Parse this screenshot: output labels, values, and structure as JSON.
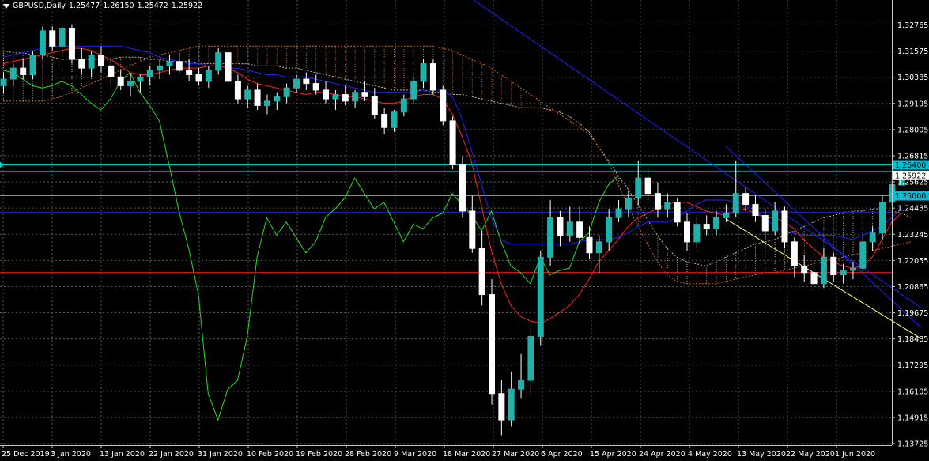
{
  "header": {
    "symbol": "GBPUSD,Daily",
    "open": "1.25477",
    "high": "1.26150",
    "low": "1.25472",
    "close": "1.25922"
  },
  "colors": {
    "background": "#000000",
    "grid": "#5a5a5a",
    "axis": "#c8c8c8",
    "bull_body": "#20b2aa",
    "bear_body": "#ffffff",
    "tenkan": "#ff2020",
    "kijun": "#2020ff",
    "chikou": "#20e020",
    "cloud_a": "#d2b48c",
    "cloud_b": "#d2691e",
    "trendline_blue": "#2020ff",
    "trendline_yellow": "#ffff80",
    "hline": "#00c8c8",
    "price_tag_bg": "#00bcd4"
  },
  "price_axis": {
    "ticks": [
      "1.32765",
      "1.31575",
      "1.30385",
      "1.29195",
      "1.28005",
      "1.26815",
      "1.25625",
      "1.24435",
      "1.23245",
      "1.22055",
      "1.20865",
      "1.19675",
      "1.18485",
      "1.17295",
      "1.16105",
      "1.14915",
      "1.13725"
    ],
    "range": [
      1.13725,
      1.32765
    ]
  },
  "price_labels": [
    {
      "text": "1.26400",
      "value": 1.264,
      "kind": "hline"
    },
    {
      "text": "1.25922",
      "value": 1.25922,
      "kind": "current"
    },
    {
      "text": "1.25000",
      "value": 1.25,
      "kind": "hline"
    }
  ],
  "time_axis": {
    "labels": [
      "25 Dec 2019",
      "3 Jan 2020",
      "13 Jan 2020",
      "22 Jan 2020",
      "31 Jan 2020",
      "10 Feb 2020",
      "19 Feb 2020",
      "28 Feb 2020",
      "9 Mar 2020",
      "18 Mar 2020",
      "27 Mar 2020",
      "6 Apr 2020",
      "15 Apr 2020",
      "24 Apr 2020",
      "4 May 2020",
      "13 May 2020",
      "22 May 2020",
      "1 Jun 2020"
    ]
  },
  "chart_data": {
    "type": "candlestick",
    "symbol": "GBPUSD",
    "timeframe": "Daily",
    "ylim": [
      1.13725,
      1.32765
    ],
    "hlines": [
      1.264,
      1.261,
      1.25,
      1.2425,
      1.215
    ],
    "candles": [
      [
        1.3,
        1.306,
        1.297,
        1.303
      ],
      [
        1.303,
        1.31,
        1.3,
        1.308
      ],
      [
        1.308,
        1.312,
        1.303,
        1.305
      ],
      [
        1.305,
        1.316,
        1.303,
        1.314
      ],
      [
        1.314,
        1.327,
        1.312,
        1.325
      ],
      [
        1.325,
        1.327,
        1.316,
        1.318
      ],
      [
        1.318,
        1.327,
        1.313,
        1.326
      ],
      [
        1.326,
        1.328,
        1.31,
        1.312
      ],
      [
        1.312,
        1.317,
        1.305,
        1.308
      ],
      [
        1.308,
        1.316,
        1.304,
        1.314
      ],
      [
        1.314,
        1.318,
        1.306,
        1.309
      ],
      [
        1.309,
        1.313,
        1.3,
        1.304
      ],
      [
        1.304,
        1.307,
        1.298,
        1.3
      ],
      [
        1.3,
        1.306,
        1.295,
        1.302
      ],
      [
        1.302,
        1.305,
        1.297,
        1.304
      ],
      [
        1.304,
        1.309,
        1.3,
        1.307
      ],
      [
        1.307,
        1.312,
        1.303,
        1.309
      ],
      [
        1.309,
        1.314,
        1.305,
        1.311
      ],
      [
        1.311,
        1.315,
        1.306,
        1.307
      ],
      [
        1.307,
        1.312,
        1.302,
        1.305
      ],
      [
        1.305,
        1.308,
        1.3,
        1.302
      ],
      [
        1.302,
        1.309,
        1.299,
        1.307
      ],
      [
        1.307,
        1.317,
        1.305,
        1.315
      ],
      [
        1.315,
        1.319,
        1.3,
        1.302
      ],
      [
        1.302,
        1.305,
        1.292,
        1.294
      ],
      [
        1.294,
        1.3,
        1.29,
        1.298
      ],
      [
        1.298,
        1.301,
        1.289,
        1.291
      ],
      [
        1.291,
        1.296,
        1.287,
        1.293
      ],
      [
        1.293,
        1.297,
        1.289,
        1.295
      ],
      [
        1.295,
        1.301,
        1.292,
        1.299
      ],
      [
        1.299,
        1.305,
        1.297,
        1.303
      ],
      [
        1.303,
        1.306,
        1.298,
        1.301
      ],
      [
        1.301,
        1.305,
        1.296,
        1.298
      ],
      [
        1.298,
        1.302,
        1.292,
        1.294
      ],
      [
        1.294,
        1.298,
        1.289,
        1.296
      ],
      [
        1.296,
        1.3,
        1.291,
        1.293
      ],
      [
        1.293,
        1.298,
        1.29,
        1.297
      ],
      [
        1.297,
        1.302,
        1.293,
        1.295
      ],
      [
        1.295,
        1.299,
        1.285,
        1.287
      ],
      [
        1.287,
        1.29,
        1.278,
        1.281
      ],
      [
        1.281,
        1.289,
        1.279,
        1.288
      ],
      [
        1.288,
        1.296,
        1.286,
        1.294
      ],
      [
        1.294,
        1.304,
        1.292,
        1.302
      ],
      [
        1.302,
        1.312,
        1.299,
        1.31
      ],
      [
        1.31,
        1.312,
        1.296,
        1.298
      ],
      [
        1.298,
        1.3,
        1.282,
        1.284
      ],
      [
        1.284,
        1.286,
        1.262,
        1.264
      ],
      [
        1.264,
        1.268,
        1.24,
        1.243
      ],
      [
        1.243,
        1.25,
        1.224,
        1.226
      ],
      [
        1.226,
        1.234,
        1.2,
        1.205
      ],
      [
        1.205,
        1.212,
        1.155,
        1.16
      ],
      [
        1.16,
        1.166,
        1.141,
        1.148
      ],
      [
        1.148,
        1.17,
        1.145,
        1.162
      ],
      [
        1.162,
        1.178,
        1.158,
        1.166
      ],
      [
        1.166,
        1.19,
        1.16,
        1.186
      ],
      [
        1.186,
        1.225,
        1.182,
        1.222
      ],
      [
        1.222,
        1.248,
        1.218,
        1.24
      ],
      [
        1.24,
        1.243,
        1.227,
        1.232
      ],
      [
        1.232,
        1.245,
        1.229,
        1.238
      ],
      [
        1.238,
        1.245,
        1.228,
        1.231
      ],
      [
        1.231,
        1.236,
        1.221,
        1.224
      ],
      [
        1.224,
        1.232,
        1.215,
        1.229
      ],
      [
        1.229,
        1.244,
        1.225,
        1.24
      ],
      [
        1.24,
        1.248,
        1.238,
        1.244
      ],
      [
        1.244,
        1.252,
        1.24,
        1.249
      ],
      [
        1.249,
        1.266,
        1.246,
        1.258
      ],
      [
        1.258,
        1.263,
        1.248,
        1.251
      ],
      [
        1.251,
        1.256,
        1.24,
        1.244
      ],
      [
        1.244,
        1.251,
        1.24,
        1.247
      ],
      [
        1.247,
        1.249,
        1.236,
        1.238
      ],
      [
        1.238,
        1.242,
        1.225,
        1.229
      ],
      [
        1.229,
        1.24,
        1.226,
        1.237
      ],
      [
        1.237,
        1.241,
        1.232,
        1.235
      ],
      [
        1.235,
        1.243,
        1.232,
        1.24
      ],
      [
        1.24,
        1.246,
        1.238,
        1.242
      ],
      [
        1.242,
        1.266,
        1.24,
        1.251
      ],
      [
        1.251,
        1.254,
        1.243,
        1.246
      ],
      [
        1.246,
        1.25,
        1.238,
        1.241
      ],
      [
        1.241,
        1.244,
        1.23,
        1.234
      ],
      [
        1.234,
        1.247,
        1.232,
        1.243
      ],
      [
        1.243,
        1.245,
        1.226,
        1.229
      ],
      [
        1.229,
        1.231,
        1.213,
        1.218
      ],
      [
        1.218,
        1.223,
        1.211,
        1.215
      ],
      [
        1.215,
        1.219,
        1.207,
        1.21
      ],
      [
        1.21,
        1.226,
        1.208,
        1.222
      ],
      [
        1.222,
        1.224,
        1.211,
        1.214
      ],
      [
        1.214,
        1.219,
        1.21,
        1.216
      ],
      [
        1.216,
        1.22,
        1.212,
        1.217
      ],
      [
        1.217,
        1.232,
        1.215,
        1.229
      ],
      [
        1.229,
        1.236,
        1.225,
        1.233
      ],
      [
        1.233,
        1.25,
        1.23,
        1.247
      ],
      [
        1.247,
        1.26,
        1.245,
        1.255
      ],
      [
        1.2548,
        1.2615,
        1.2547,
        1.2592
      ]
    ],
    "tenkan": [
      1.31,
      1.311,
      1.312,
      1.313,
      1.314,
      1.315,
      1.316,
      1.317,
      1.317,
      1.316,
      1.314,
      1.312,
      1.309,
      1.306,
      1.305,
      1.305,
      1.306,
      1.307,
      1.308,
      1.308,
      1.308,
      1.309,
      1.309,
      1.308,
      1.306,
      1.303,
      1.301,
      1.3,
      1.299,
      1.298,
      1.297,
      1.296,
      1.297,
      1.297,
      1.296,
      1.295,
      1.295,
      1.294,
      1.293,
      1.292,
      1.292,
      1.293,
      1.295,
      1.296,
      1.296,
      1.294,
      1.287,
      1.277,
      1.265,
      1.245,
      1.225,
      1.21,
      1.2,
      1.195,
      1.193,
      1.192,
      1.194,
      1.197,
      1.2,
      1.205,
      1.212,
      1.22,
      1.225,
      1.23,
      1.236,
      1.24,
      1.242,
      1.244,
      1.246,
      1.247,
      1.247,
      1.245,
      1.243,
      1.242,
      1.241,
      1.243,
      1.244,
      1.242,
      1.24,
      1.24,
      1.238,
      1.235,
      1.23,
      1.226,
      1.222,
      1.22,
      1.218,
      1.217,
      1.218,
      1.222,
      1.23,
      1.238,
      1.242
    ],
    "kijun": [
      1.313,
      1.314,
      1.315,
      1.316,
      1.317,
      1.318,
      1.318,
      1.318,
      1.318,
      1.318,
      1.318,
      1.318,
      1.318,
      1.317,
      1.316,
      1.315,
      1.313,
      1.312,
      1.311,
      1.31,
      1.31,
      1.309,
      1.309,
      1.308,
      1.308,
      1.307,
      1.306,
      1.305,
      1.305,
      1.304,
      1.304,
      1.304,
      1.303,
      1.302,
      1.301,
      1.3,
      1.299,
      1.298,
      1.297,
      1.297,
      1.297,
      1.297,
      1.297,
      1.298,
      1.298,
      1.298,
      1.295,
      1.285,
      1.27,
      1.255,
      1.24,
      1.23,
      1.228,
      1.228,
      1.228,
      1.228,
      1.228,
      1.228,
      1.228,
      1.229,
      1.23,
      1.23,
      1.23,
      1.231,
      1.233,
      1.236,
      1.238,
      1.238,
      1.238,
      1.24,
      1.243,
      1.246,
      1.248,
      1.248,
      1.248,
      1.247,
      1.246,
      1.243,
      1.24,
      1.236,
      1.234,
      1.233,
      1.232,
      1.232,
      1.232,
      1.232,
      1.231,
      1.23,
      1.232,
      1.234,
      1.236,
      1.24,
      1.244
    ],
    "chikou": [
      1.307,
      1.306,
      1.303,
      1.3,
      1.299,
      1.3,
      1.302,
      1.3,
      1.296,
      1.292,
      1.289,
      1.294,
      1.302,
      1.306,
      1.297,
      1.291,
      1.284,
      1.264,
      1.243,
      1.226,
      1.205,
      1.16,
      1.148,
      1.162,
      1.166,
      1.186,
      1.222,
      1.24,
      1.232,
      1.238,
      1.231,
      1.224,
      1.229,
      1.24,
      1.244,
      1.249,
      1.258,
      1.251,
      1.244,
      1.247,
      1.238,
      1.229,
      1.237,
      1.235,
      1.24,
      1.242,
      1.251,
      1.246,
      1.241,
      1.234,
      1.243,
      1.229,
      1.218,
      1.215,
      1.21,
      1.222,
      1.214,
      1.216,
      1.217,
      1.229,
      1.233,
      1.247,
      1.255,
      1.259
    ],
    "senkou_a": [
      1.316,
      1.315,
      1.315,
      1.314,
      1.314,
      1.313,
      1.312,
      1.312,
      1.312,
      1.312,
      1.312,
      1.312,
      1.313,
      1.313,
      1.313,
      1.312,
      1.312,
      1.311,
      1.311,
      1.311,
      1.31,
      1.31,
      1.31,
      1.31,
      1.31,
      1.31,
      1.309,
      1.309,
      1.309,
      1.308,
      1.308,
      1.307,
      1.306,
      1.305,
      1.304,
      1.303,
      1.302,
      1.301,
      1.3,
      1.299,
      1.298,
      1.298,
      1.298,
      1.298,
      1.297,
      1.297,
      1.296,
      1.296,
      1.295,
      1.294,
      1.293,
      1.292,
      1.291,
      1.29,
      1.29,
      1.29,
      1.289,
      1.288,
      1.286,
      1.283,
      1.279,
      1.272,
      1.266,
      1.259,
      1.253,
      1.246,
      1.239,
      1.232,
      1.226,
      1.222,
      1.22,
      1.219,
      1.218,
      1.22,
      1.222,
      1.224,
      1.226,
      1.228,
      1.229,
      1.23,
      1.232,
      1.234,
      1.236,
      1.238,
      1.24,
      1.241,
      1.242,
      1.243,
      1.243,
      1.244,
      1.244,
      1.243,
      1.242,
      1.24
    ],
    "senkou_b": [
      1.293,
      1.293,
      1.293,
      1.293,
      1.293,
      1.294,
      1.295,
      1.297,
      1.299,
      1.301,
      1.303,
      1.305,
      1.307,
      1.309,
      1.311,
      1.313,
      1.314,
      1.315,
      1.316,
      1.317,
      1.318,
      1.318,
      1.318,
      1.318,
      1.318,
      1.318,
      1.318,
      1.318,
      1.318,
      1.318,
      1.318,
      1.318,
      1.318,
      1.318,
      1.318,
      1.318,
      1.318,
      1.318,
      1.318,
      1.318,
      1.318,
      1.318,
      1.318,
      1.318,
      1.318,
      1.317,
      1.316,
      1.314,
      1.312,
      1.31,
      1.308,
      1.305,
      1.302,
      1.299,
      1.296,
      1.293,
      1.29,
      1.287,
      1.284,
      1.281,
      1.278,
      1.272,
      1.265,
      1.255,
      1.245,
      1.236,
      1.228,
      1.22,
      1.214,
      1.211,
      1.21,
      1.21,
      1.21,
      1.21,
      1.211,
      1.212,
      1.213,
      1.214,
      1.215,
      1.215,
      1.216,
      1.217,
      1.218,
      1.219,
      1.22,
      1.221,
      1.222,
      1.223,
      1.224,
      1.225,
      1.226,
      1.227,
      1.228,
      1.229
    ],
    "trendlines": [
      {
        "color": "blue",
        "from": [
          48,
          1.3395
        ],
        "to": [
          94,
          1.199
        ]
      },
      {
        "color": "blue",
        "from": [
          74,
          1.2725
        ],
        "to": [
          94,
          1.19
        ]
      },
      {
        "color": "yellow",
        "from": [
          74,
          1.2395
        ],
        "to": [
          94,
          1.185
        ]
      }
    ]
  }
}
